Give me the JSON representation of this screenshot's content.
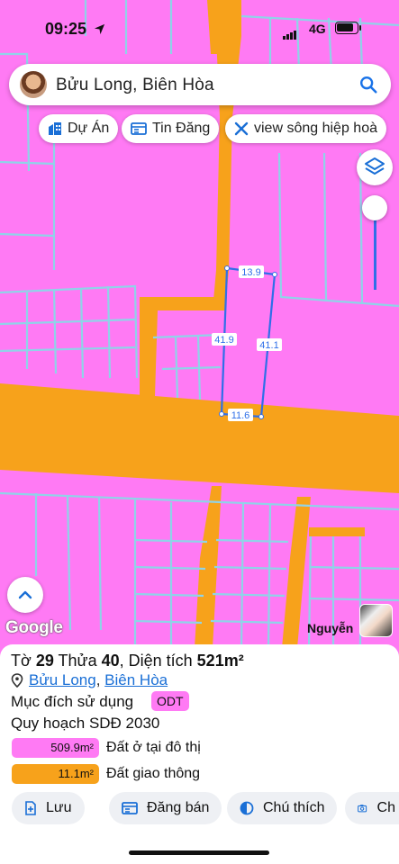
{
  "status_bar": {
    "time": "09:25",
    "network": "4G"
  },
  "search": {
    "text": "Bửu Long, Biên Hòa"
  },
  "chips": [
    {
      "label": "Dự Án",
      "icon": "building-icon"
    },
    {
      "label": "Tin Đăng",
      "icon": "listing-icon"
    },
    {
      "label": "view sông hiệp hoà",
      "icon": "tools-icon"
    }
  ],
  "map": {
    "colors": {
      "residential": "#ff7af4",
      "road": "#f7a21b",
      "parcel_line": "#8fd3e8",
      "selection": "#2f6fe8"
    },
    "dimensions": {
      "top": "13.9",
      "left": "41.9",
      "right": "41.1",
      "bottom": "11.6"
    },
    "google_logo": "Google",
    "agent_name": "Nguyễn"
  },
  "sheet": {
    "title_prefix": "Tờ ",
    "sheet_no": "29",
    "title_mid": " Thửa ",
    "parcel_no": "40",
    "area_label": ", Diện tích ",
    "area_value": "521m²",
    "ward": "Bửu Long",
    "city": "Biên Hòa",
    "purpose_label": "Mục đích sử dụng",
    "purpose_code": "ODT",
    "plan_label": "Quy hoạch SDĐ 2030",
    "legend": [
      {
        "value": "509.9m²",
        "label": "Đất ở tại đô thị",
        "color": "#ff7af4"
      },
      {
        "value": "11.1m²",
        "label": "Đất giao thông",
        "color": "#f7a21b"
      }
    ],
    "actions": [
      {
        "label": "Lưu",
        "icon": "save-icon"
      },
      {
        "label": "Đăng bán",
        "icon": "post-icon"
      },
      {
        "label": "Chú thích",
        "icon": "legend-icon"
      },
      {
        "label": "Ch",
        "icon": "camera-icon"
      }
    ]
  }
}
